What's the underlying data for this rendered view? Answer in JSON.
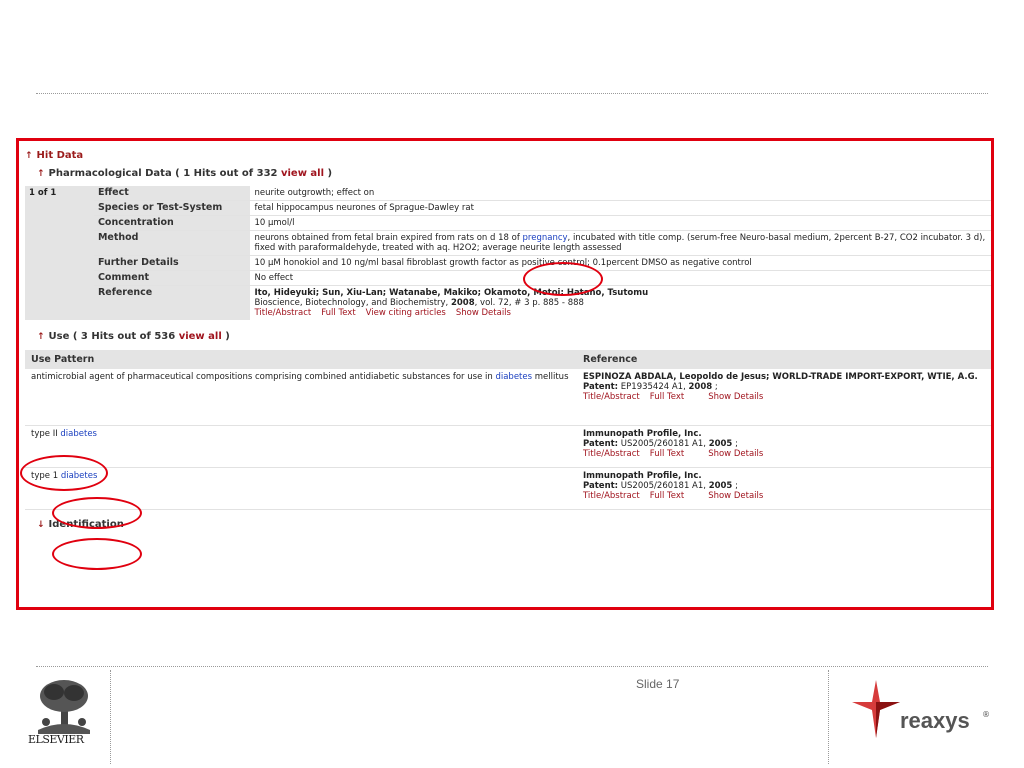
{
  "hit_data": {
    "title": "Hit Data"
  },
  "pharm": {
    "title_prefix": "Pharmacological Data ( 1 Hits out of 332 ",
    "view_all": "view all",
    "title_suffix": " )",
    "index": "1 of 1",
    "rows": {
      "effect": {
        "label": "Effect",
        "value": "neurite outgrowth; effect on"
      },
      "species": {
        "label": "Species or Test-System",
        "value": "fetal hippocampus neurones of Sprague-Dawley rat"
      },
      "concentration": {
        "label": "Concentration",
        "value": "10 µmol/l"
      },
      "method": {
        "label": "Method",
        "value_a": "neurons obtained from fetal brain expired from rats on d 18 of ",
        "value_link": "pregnancy",
        "value_b": ", incubated with title comp. (serum-free Neuro-basal medium, 2percent B-27, CO2 incubator. 3 d), fixed with paraformaldehyde, treated with aq. H2O2; average neurite length assessed"
      },
      "further": {
        "label": "Further Details",
        "value": "10 µM honokiol and 10 ng/ml basal fibroblast growth factor as positive control; 0.1percent DMSO as negative control"
      },
      "comment": {
        "label": "Comment",
        "value": "No effect"
      },
      "reference": {
        "label": "Reference",
        "authors": "Ito, Hideyuki; Sun, Xiu-Lan; Watanabe, Makiko; Okamoto, Motoi; Hatano, Tsutomu",
        "journal_prefix": "Bioscience, Biotechnology, and Biochemistry,",
        "year": "2008",
        "journal_suffix": ", vol. 72, # 3  p. 885 - 888",
        "links": [
          "Title/Abstract",
          "Full Text",
          "View citing articles",
          "Show Details"
        ]
      }
    }
  },
  "use": {
    "title_prefix": "Use ( 3 Hits out of 536 ",
    "view_all": "view all",
    "title_suffix": " )",
    "headers": {
      "pattern": "Use Pattern",
      "reference": "Reference"
    },
    "rows": [
      {
        "pattern_pre": "antimicrobial agent of pharmaceutical compositions comprising combined antidiabetic substances for use in ",
        "pattern_link": "diabetes",
        "pattern_post": " mellitus",
        "ref_name": "ESPINOZA ABDALA, Leopoldo de Jesus; WORLD-TRADE IMPORT-EXPORT, WTIE, A.G.",
        "patent_label": "Patent:",
        "patent_no": "EP1935424 A1,",
        "year": "2008",
        "tail": ";",
        "links": [
          "Title/Abstract",
          "Full Text",
          "Show Details"
        ]
      },
      {
        "pattern_pre": "type II ",
        "pattern_link": "diabetes",
        "pattern_post": "",
        "ref_name": "Immunopath Profile, Inc.",
        "patent_label": "Patent:",
        "patent_no": "US2005/260181 A1,",
        "year": "2005",
        "tail": ";",
        "links": [
          "Title/Abstract",
          "Full Text",
          "Show Details"
        ]
      },
      {
        "pattern_pre": "type 1 ",
        "pattern_link": "diabetes",
        "pattern_post": "",
        "ref_name": "Immunopath Profile, Inc.",
        "patent_label": "Patent:",
        "patent_no": "US2005/260181 A1,",
        "year": "2005",
        "tail": ";",
        "links": [
          "Title/Abstract",
          "Full Text",
          "Show Details"
        ]
      }
    ]
  },
  "identification": {
    "title": "Identification"
  },
  "footer": {
    "publisher": "ELSEVIER",
    "slide": "Slide 17",
    "brand": "reaxys",
    "registered": "®"
  },
  "colors": {
    "accent_red": "#e0000f",
    "link_red": "#a0141e",
    "link_blue": "#1a3fbf",
    "label_bg": "#e4e4e4"
  },
  "icons": [
    "arrow-up-icon",
    "elsevier-tree-logo",
    "reaxys-logo"
  ]
}
